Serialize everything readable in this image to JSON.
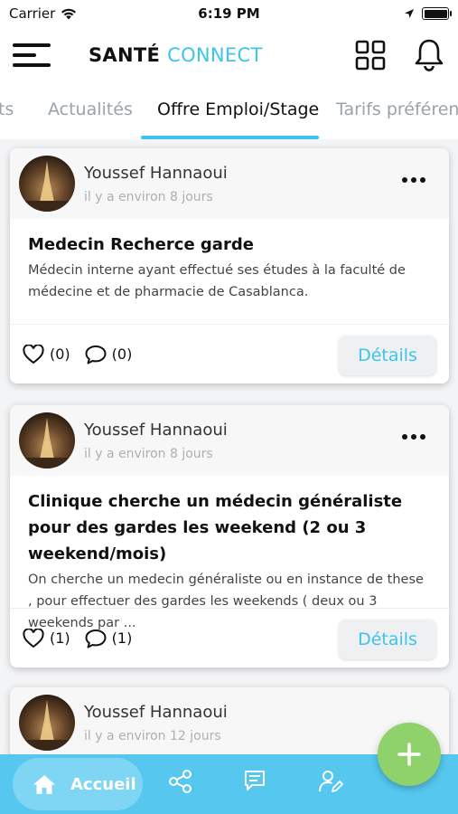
{
  "status_bar": {
    "carrier": "Carrier",
    "time": "6:19 PM",
    "battery_level": 1.0
  },
  "header": {
    "brand_part1": "SANTÉ",
    "brand_part2": "CONNECT",
    "icons": [
      "menu-icon",
      "grid-icon",
      "bell-icon"
    ]
  },
  "tabs": [
    {
      "label": "ts"
    },
    {
      "label": "Actualités"
    },
    {
      "label": "Offre Emploi/Stage",
      "active": true
    },
    {
      "label": "Tarifs préférentie"
    }
  ],
  "posts": [
    {
      "author": "Youssef Hannaoui",
      "time": "il y a environ 8 jours",
      "title": "Medecin Recherce garde",
      "description": "Médecin interne ayant effectué ses études à la faculté de médecine et de pharmacie de Casablanca.",
      "likes": "(0)",
      "comments": "(0)",
      "details_label": "Détails"
    },
    {
      "author": "Youssef Hannaoui",
      "time": "il y a environ 8 jours",
      "title": "Clinique cherche un médecin généraliste pour des gardes les weekend (2 ou 3 weekend/mois)",
      "description": "On cherche un medecin généraliste ou en instance de these , pour effectuer des gardes les weekends ( deux ou 3 weekends par ...",
      "likes": "(1)",
      "comments": "(1)",
      "details_label": "Détails"
    },
    {
      "author": "Youssef Hannaoui",
      "time": "il y a environ 12 jours"
    }
  ],
  "bottom_nav": {
    "home_label": "Accueil",
    "icons": [
      "home-icon",
      "share-icon",
      "chat-icon",
      "user-edit-icon"
    ]
  },
  "fab": {
    "icon": "plus-icon"
  },
  "colors": {
    "accent": "#3ec3ee",
    "nav_bg": "#56c8ef",
    "fab": "#8fd16a",
    "tab_inactive": "#9aa3aa"
  }
}
